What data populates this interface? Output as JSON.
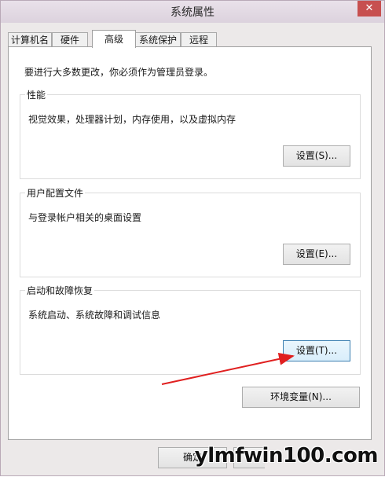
{
  "window": {
    "title": "系统属性",
    "close_glyph": "✕"
  },
  "tabs": [
    {
      "label": "计算机名"
    },
    {
      "label": "硬件"
    },
    {
      "label": "高级"
    },
    {
      "label": "系统保护"
    },
    {
      "label": "远程"
    }
  ],
  "active_tab": "高级",
  "notice": "要进行大多数更改，你必须作为管理员登录。",
  "groups": {
    "performance": {
      "title": "性能",
      "desc": "视觉效果，处理器计划，内存使用，以及虚拟内存",
      "button": "设置(S)..."
    },
    "user_profiles": {
      "title": "用户配置文件",
      "desc": "与登录帐户相关的桌面设置",
      "button": "设置(E)..."
    },
    "startup_recovery": {
      "title": "启动和故障恢复",
      "desc": "系统启动、系统故障和调试信息",
      "button": "设置(T)..."
    }
  },
  "env_button": "环境变量(N)...",
  "footer": {
    "ok": "确定"
  },
  "watermark": "ylmfwin100.com",
  "colors": {
    "annotation_arrow": "#e02020",
    "focus_border": "#3c7fb1"
  }
}
